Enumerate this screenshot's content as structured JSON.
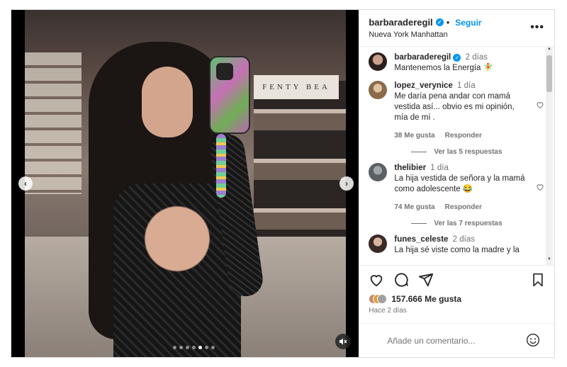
{
  "header": {
    "username": "barbaraderegil",
    "follow_label": "Seguir",
    "location": "Nueva York Manhattan",
    "more_label": "•••"
  },
  "media": {
    "sign_text": "FENTY BEA",
    "carousel_count": 7,
    "carousel_active": 5
  },
  "comments": [
    {
      "username": "barbaraderegil",
      "time": "2 días",
      "text": "Mantenemos la Energía 🧚",
      "verified": true
    },
    {
      "username": "lopez_verynice",
      "time": "1 día",
      "text": "Me daría pena andar con mamá vestida así... obvio es mi opinión, mía de mí .",
      "likes": "38 Me gusta",
      "reply_label": "Responder",
      "replies_label": "Ver las 5 respuestas"
    },
    {
      "username": "thelibier",
      "time": "1 día",
      "text": "La hija vestida de señora y la mamá como adolescente 😂",
      "likes": "74 Me gusta",
      "reply_label": "Responder",
      "replies_label": "Ver las 7 respuestas"
    },
    {
      "username": "funes_celeste",
      "time": "2 días",
      "text": "La hija sé viste como la madre y la"
    }
  ],
  "actions": {
    "likes_count": "157.666 Me gusta",
    "posted": "Hace 2 días"
  },
  "add_comment": {
    "placeholder": "Añade un comentario..."
  },
  "colors": {
    "accent": "#0095f6",
    "muted": "#737373"
  }
}
